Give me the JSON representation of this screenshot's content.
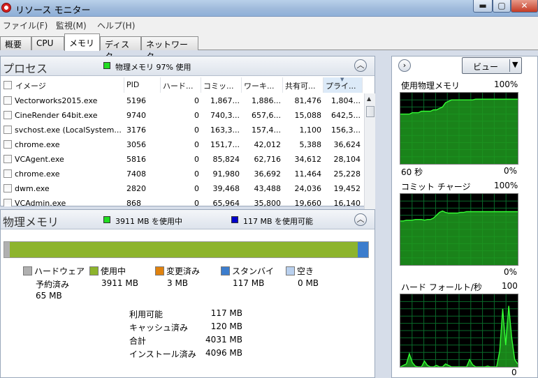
{
  "window": {
    "title": "リソース モニター",
    "min": "▬",
    "max": "▢",
    "close": "✕"
  },
  "menu": [
    "ファイル(F)",
    "監視(M)",
    "ヘルプ(H)"
  ],
  "tabs": [
    {
      "label": "概要"
    },
    {
      "label": "CPU"
    },
    {
      "label": "メモリ",
      "active": true
    },
    {
      "label": "ディスク"
    },
    {
      "label": "ネットワーク"
    }
  ],
  "process_panel": {
    "title": "プロセス",
    "legend_color": "#22dd22",
    "legend_text": "物理メモリ 97% 使用",
    "collapse_icon": "chevron-up-icon",
    "columns": [
      "イメージ",
      "PID",
      "ハード...",
      "コミッ...",
      "ワーキ...",
      "共有可...",
      "プライ..."
    ],
    "rows": [
      [
        "Vectorworks2015.exe",
        "5196",
        "0",
        "1,867...",
        "1,886...",
        "81,476",
        "1,804..."
      ],
      [
        "CineRender 64bit.exe",
        "9740",
        "0",
        "740,3...",
        "657,6...",
        "15,088",
        "642,5..."
      ],
      [
        "svchost.exe (LocalSystem...",
        "3176",
        "0",
        "163,3...",
        "157,4...",
        "1,100",
        "156,3..."
      ],
      [
        "chrome.exe",
        "3056",
        "0",
        "151,7...",
        "42,012",
        "5,388",
        "36,624"
      ],
      [
        "VCAgent.exe",
        "5816",
        "0",
        "85,824",
        "62,716",
        "34,612",
        "28,104"
      ],
      [
        "chrome.exe",
        "7408",
        "0",
        "91,980",
        "36,692",
        "11,464",
        "25,228"
      ],
      [
        "dwm.exe",
        "2820",
        "0",
        "39,468",
        "43,488",
        "24,036",
        "19,452"
      ],
      [
        "VCAdmin.exe",
        "868",
        "0",
        "65,964",
        "35,800",
        "19,660",
        "16,140"
      ]
    ]
  },
  "memory_panel": {
    "title": "物理メモリ",
    "legend_used_color": "#22dd22",
    "legend_used": "3911 MB を使用中",
    "legend_avail_color": "#0000cc",
    "legend_avail": "117 MB を使用可能",
    "bar": {
      "hardware": 65,
      "in_use": 3911,
      "modified": 3,
      "standby": 117,
      "free": 0
    },
    "legend": [
      {
        "label": "ハードウェア",
        "sub": "予約済み",
        "value": "65 MB",
        "color": "#b0b0b0"
      },
      {
        "label": "使用中",
        "value": "3911 MB",
        "color": "#8db42d"
      },
      {
        "label": "変更済み",
        "value": "3 MB",
        "color": "#e0820e"
      },
      {
        "label": "スタンバイ",
        "value": "117 MB",
        "color": "#3c7dcd"
      },
      {
        "label": "空き",
        "value": "0 MB",
        "color": "#b9d0ee"
      }
    ],
    "stats": [
      {
        "label": "利用可能",
        "value": "117 MB"
      },
      {
        "label": "キャッシュ済み",
        "value": "120 MB"
      },
      {
        "label": "合計",
        "value": "4031 MB"
      },
      {
        "label": "インストール済み",
        "value": "4096 MB"
      }
    ]
  },
  "right_panel": {
    "nav_icon": "chevron-right-icon",
    "view_label": "ビュー",
    "view_arrow": "▼",
    "graphs": [
      {
        "label": "使用物理メモリ",
        "max": "100%",
        "bottom_left": "60 秒",
        "bottom_right": "0%"
      },
      {
        "label": "コミット チャージ",
        "max": "100%",
        "bottom_left": "",
        "bottom_right": "0%"
      },
      {
        "label": "ハード フォールト/秒",
        "max": "100",
        "bottom_left": "",
        "bottom_right": "0"
      }
    ],
    "series": {
      "physical_memory_pct": [
        70,
        70,
        70,
        70,
        72,
        72,
        72,
        74,
        74,
        74,
        74,
        76,
        76,
        78,
        80,
        86,
        88,
        90,
        90,
        90,
        90,
        90,
        90,
        90,
        90,
        91,
        91,
        91,
        91,
        91,
        91,
        91,
        91,
        91,
        91,
        91,
        91,
        91,
        91,
        91
      ],
      "commit_charge_pct": [
        62,
        62,
        63,
        63,
        63,
        64,
        64,
        64,
        63,
        64,
        64,
        66,
        70,
        74,
        76,
        74,
        73,
        73,
        73,
        73,
        74,
        74,
        75,
        75,
        75,
        75,
        75,
        75,
        75,
        75,
        75,
        75,
        75,
        75,
        75,
        75,
        75,
        75,
        75,
        75
      ],
      "hard_faults": [
        0,
        2,
        4,
        18,
        6,
        1,
        0,
        0,
        8,
        2,
        0,
        0,
        2,
        0,
        0,
        4,
        2,
        0,
        0,
        0,
        0,
        0,
        0,
        10,
        3,
        0,
        0,
        0,
        0,
        1,
        0,
        0,
        0,
        22,
        80,
        30,
        84,
        40,
        10,
        4
      ]
    }
  }
}
